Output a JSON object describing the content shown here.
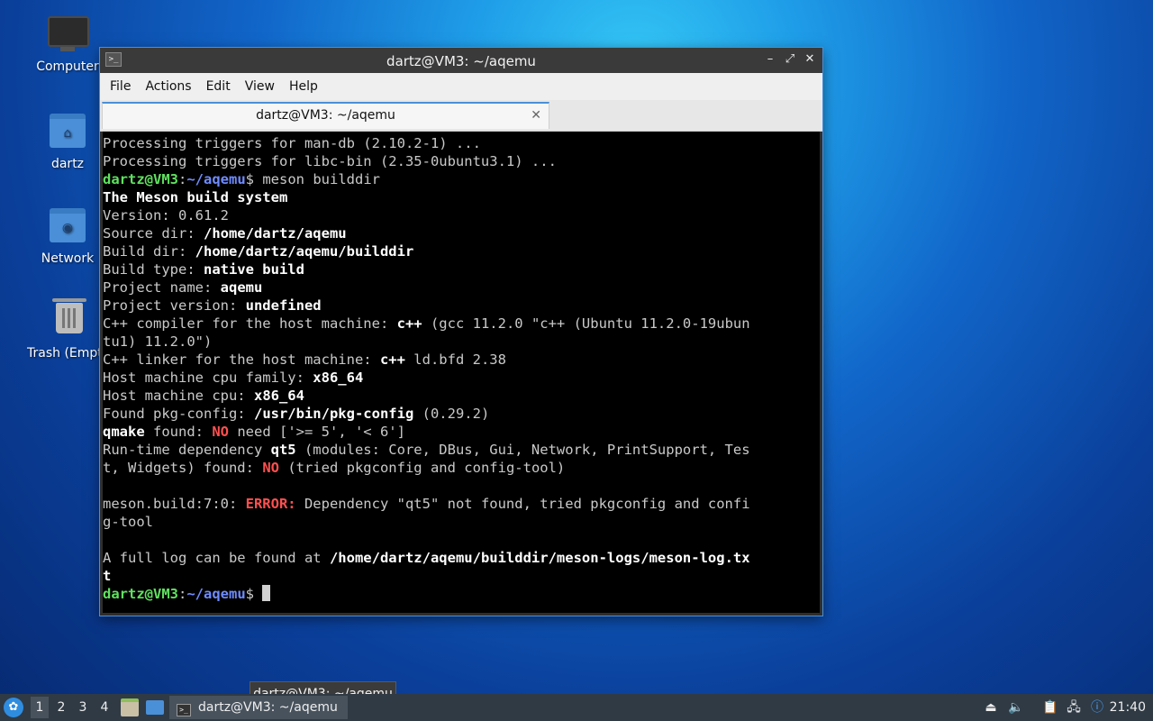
{
  "desktop": {
    "icons": [
      {
        "label": "Computer"
      },
      {
        "label": "dartz"
      },
      {
        "label": "Network"
      },
      {
        "label": "Trash (Empt"
      }
    ]
  },
  "window": {
    "title": "dartz@VM3: ~/aqemu",
    "menu": [
      "File",
      "Actions",
      "Edit",
      "View",
      "Help"
    ],
    "tab_label": "dartz@VM3: ~/aqemu",
    "controls": {
      "minimize": "–",
      "maximize": "⤢",
      "close": "✕"
    }
  },
  "terminal": {
    "l1": "Processing triggers for man-db (2.10.2-1) ...",
    "l2": "Processing triggers for libc-bin (2.35-0ubuntu3.1) ...",
    "prompt_user": "dartz@VM3",
    "prompt_colon": ":",
    "prompt_path": "~/aqemu",
    "prompt_dollar": "$",
    "l3_cmd": " meson builddir",
    "l4": "The Meson build system",
    "l5": "Version: 0.61.2",
    "l6_label": "Source dir: ",
    "l6_value": "/home/dartz/aqemu",
    "l7_label": "Build dir: ",
    "l7_value": "/home/dartz/aqemu/builddir",
    "l8_label": "Build type: ",
    "l8_value": "native build",
    "l9_label": "Project name: ",
    "l9_value": "aqemu",
    "l10_label": "Project version: ",
    "l10_value": "undefined",
    "l11_label": "C++ compiler for the host machine: ",
    "l11_value": "c++",
    "l11_rest": " (gcc 11.2.0 \"c++ (Ubuntu 11.2.0-19ubun",
    "l12": "tu1) 11.2.0\")",
    "l13_label": "C++ linker for the host machine: ",
    "l13_value": "c++",
    "l13_rest": " ld.bfd 2.38",
    "l14_label": "Host machine cpu family: ",
    "l14_value": "x86_64",
    "l15_label": "Host machine cpu: ",
    "l15_value": "x86_64",
    "l16_label": "Found pkg-config: ",
    "l16_value": "/usr/bin/pkg-config",
    "l16_rest": " (0.29.2)",
    "l17_value": "qmake",
    "l17_mid": " found: ",
    "l17_no": "NO",
    "l17_rest": " need ['>= 5', '< 6']",
    "l18_label": "Run-time dependency ",
    "l18_value": "qt5",
    "l18_rest": " (modules: Core, DBus, Gui, Network, PrintSupport, Tes",
    "l19_label": "t, Widgets) found: ",
    "l19_no": "NO",
    "l19_rest": " (tried pkgconfig and config-tool)",
    "l20_label": "meson.build:7:0: ",
    "l20_err": "ERROR:",
    "l20_rest": " Dependency \"qt5\" not found, tried pkgconfig and confi",
    "l21": "g-tool",
    "l22_label": "A full log can be found at ",
    "l22_value": "/home/dartz/aqemu/builddir/meson-logs/meson-log.tx",
    "l23_value": "t"
  },
  "tooltip": "dartz@VM3: ~/aqemu",
  "taskbar": {
    "workspaces": [
      "1",
      "2",
      "3",
      "4"
    ],
    "task_label": "dartz@VM3: ~/aqemu",
    "clock": "21:40"
  }
}
